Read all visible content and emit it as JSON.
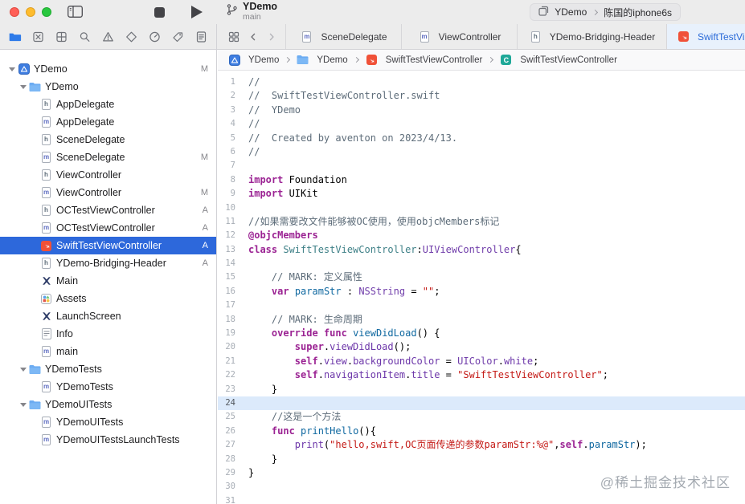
{
  "colors": {
    "accent_selection": "#2D68DB",
    "swift_orange": "#F05138",
    "active_tab_text": "#2A6AD8",
    "current_line_highlight": "#DCEAFB"
  },
  "titlebar": {
    "project": "YDemo",
    "branch": "main"
  },
  "run_destination": {
    "scheme": "YDemo",
    "device": "陈国的iphone6s"
  },
  "navigators": [
    {
      "name": "project-navigator",
      "icon": "folder",
      "active": true
    },
    {
      "name": "source-control-navigator",
      "icon": "square-x",
      "active": false
    },
    {
      "name": "symbol-navigator",
      "icon": "grid",
      "active": false
    },
    {
      "name": "find-navigator",
      "icon": "search",
      "active": false
    },
    {
      "name": "issue-navigator",
      "icon": "warning",
      "active": false
    },
    {
      "name": "test-navigator",
      "icon": "diamond",
      "active": false
    },
    {
      "name": "debug-navigator",
      "icon": "gauge",
      "active": false
    },
    {
      "name": "breakpoint-navigator",
      "icon": "tag",
      "active": false
    },
    {
      "name": "report-navigator",
      "icon": "doc-list",
      "active": false
    }
  ],
  "tabs": [
    {
      "label": "SceneDelegate",
      "icon": "file-m",
      "active": false
    },
    {
      "label": "ViewController",
      "icon": "file-m",
      "active": false
    },
    {
      "label": "YDemo-Bridging-Header",
      "icon": "file-h",
      "active": false
    },
    {
      "label": "SwiftTestViewController",
      "icon": "file-swift",
      "active": true
    }
  ],
  "jumpbar": [
    {
      "label": "YDemo",
      "icon": "project"
    },
    {
      "label": "YDemo",
      "icon": "folder-file"
    },
    {
      "label": "SwiftTestViewController",
      "icon": "file-swift"
    },
    {
      "label": "SwiftTestViewController",
      "icon": "symbol-c"
    }
  ],
  "sidebar": {
    "rows": [
      {
        "label": "YDemo",
        "icon": "project",
        "indent": 0,
        "disclosure": true,
        "badge": "M"
      },
      {
        "label": "YDemo",
        "icon": "folder-file",
        "indent": 1,
        "disclosure": true
      },
      {
        "label": "AppDelegate",
        "icon": "file-h",
        "indent": 2
      },
      {
        "label": "AppDelegate",
        "icon": "file-m",
        "indent": 2
      },
      {
        "label": "SceneDelegate",
        "icon": "file-h",
        "indent": 2
      },
      {
        "label": "SceneDelegate",
        "icon": "file-m",
        "indent": 2,
        "badge": "M"
      },
      {
        "label": "ViewController",
        "icon": "file-h",
        "indent": 2
      },
      {
        "label": "ViewController",
        "icon": "file-m",
        "indent": 2,
        "badge": "M"
      },
      {
        "label": "OCTestViewController",
        "icon": "file-h",
        "indent": 2,
        "badge": "A"
      },
      {
        "label": "OCTestViewController",
        "icon": "file-m",
        "indent": 2,
        "badge": "A"
      },
      {
        "label": "SwiftTestViewController",
        "icon": "file-swift",
        "indent": 2,
        "badge": "A",
        "selected": true
      },
      {
        "label": "YDemo-Bridging-Header",
        "icon": "file-h",
        "indent": 2,
        "badge": "A"
      },
      {
        "label": "Main",
        "icon": "storyboard",
        "indent": 2
      },
      {
        "label": "Assets",
        "icon": "assets",
        "indent": 2
      },
      {
        "label": "LaunchScreen",
        "icon": "storyboard",
        "indent": 2
      },
      {
        "label": "Info",
        "icon": "plist",
        "indent": 2
      },
      {
        "label": "main",
        "icon": "file-m",
        "indent": 2
      },
      {
        "label": "YDemoTests",
        "icon": "folder-file",
        "indent": 1,
        "disclosure": true
      },
      {
        "label": "YDemoTests",
        "icon": "file-m",
        "indent": 2
      },
      {
        "label": "YDemoUITests",
        "icon": "folder-file",
        "indent": 1,
        "disclosure": true
      },
      {
        "label": "YDemoUITests",
        "icon": "file-m",
        "indent": 2
      },
      {
        "label": "YDemoUITestsLaunchTests",
        "icon": "file-m",
        "indent": 2
      }
    ]
  },
  "editor": {
    "active_line": 24,
    "lines": [
      {
        "n": 1,
        "t": [
          [
            "//",
            "cmt"
          ]
        ]
      },
      {
        "n": 2,
        "t": [
          [
            "//  SwiftTestViewController.swift",
            "cmt"
          ]
        ]
      },
      {
        "n": 3,
        "t": [
          [
            "//  YDemo",
            "cmt"
          ]
        ]
      },
      {
        "n": 4,
        "t": [
          [
            "//",
            "cmt"
          ]
        ]
      },
      {
        "n": 5,
        "t": [
          [
            "//  Created by aventon on 2023/4/13.",
            "cmt"
          ]
        ]
      },
      {
        "n": 6,
        "t": [
          [
            "//",
            "cmt"
          ]
        ]
      },
      {
        "n": 7,
        "t": []
      },
      {
        "n": 8,
        "t": [
          [
            "import",
            "kw"
          ],
          [
            " Foundation",
            "pl"
          ]
        ]
      },
      {
        "n": 9,
        "t": [
          [
            "import",
            "kw"
          ],
          [
            " UIKit",
            "pl"
          ]
        ]
      },
      {
        "n": 10,
        "t": []
      },
      {
        "n": 11,
        "t": [
          [
            "//如果需要改文件能够被OC使用，使用objcMembers标记",
            "cmt"
          ]
        ]
      },
      {
        "n": 12,
        "t": [
          [
            "@objcMembers",
            "kw"
          ]
        ]
      },
      {
        "n": 13,
        "t": [
          [
            "class",
            "kw"
          ],
          [
            " ",
            "pl"
          ],
          [
            "SwiftTestViewController",
            "cls"
          ],
          [
            ":",
            "pl"
          ],
          [
            "UIViewController",
            "typ"
          ],
          [
            "{",
            "pl"
          ]
        ]
      },
      {
        "n": 14,
        "t": []
      },
      {
        "n": 15,
        "t": [
          [
            "    ",
            "pl"
          ],
          [
            "// MARK: 定义属性",
            "cmt"
          ]
        ]
      },
      {
        "n": 16,
        "t": [
          [
            "    ",
            "pl"
          ],
          [
            "var",
            "kw"
          ],
          [
            " ",
            "pl"
          ],
          [
            "paramStr",
            "dcl"
          ],
          [
            " : ",
            "pl"
          ],
          [
            "NSString",
            "typ"
          ],
          [
            " = ",
            "pl"
          ],
          [
            "\"\"",
            "str"
          ],
          [
            ";",
            "pl"
          ]
        ]
      },
      {
        "n": 17,
        "t": []
      },
      {
        "n": 18,
        "t": [
          [
            "    ",
            "pl"
          ],
          [
            "// MARK: 生命周期",
            "cmt"
          ]
        ]
      },
      {
        "n": 19,
        "t": [
          [
            "    ",
            "pl"
          ],
          [
            "override",
            "kw"
          ],
          [
            " ",
            "pl"
          ],
          [
            "func",
            "kw"
          ],
          [
            " ",
            "pl"
          ],
          [
            "viewDidLoad",
            "dcl"
          ],
          [
            "() {",
            "pl"
          ]
        ]
      },
      {
        "n": 20,
        "t": [
          [
            "        ",
            "pl"
          ],
          [
            "super",
            "kw"
          ],
          [
            ".",
            "pl"
          ],
          [
            "viewDidLoad",
            "mem"
          ],
          [
            "();",
            "pl"
          ]
        ]
      },
      {
        "n": 21,
        "t": [
          [
            "        ",
            "pl"
          ],
          [
            "self",
            "kw"
          ],
          [
            ".",
            "pl"
          ],
          [
            "view",
            "mem"
          ],
          [
            ".",
            "pl"
          ],
          [
            "backgroundColor",
            "mem"
          ],
          [
            " = ",
            "pl"
          ],
          [
            "UIColor",
            "typ"
          ],
          [
            ".",
            "pl"
          ],
          [
            "white",
            "mem"
          ],
          [
            ";",
            "pl"
          ]
        ]
      },
      {
        "n": 22,
        "t": [
          [
            "        ",
            "pl"
          ],
          [
            "self",
            "kw"
          ],
          [
            ".",
            "pl"
          ],
          [
            "navigationItem",
            "mem"
          ],
          [
            ".",
            "pl"
          ],
          [
            "title",
            "mem"
          ],
          [
            " = ",
            "pl"
          ],
          [
            "\"SwiftTestViewController\"",
            "str"
          ],
          [
            ";",
            "pl"
          ]
        ]
      },
      {
        "n": 23,
        "t": [
          [
            "    }",
            "pl"
          ]
        ]
      },
      {
        "n": 24,
        "t": []
      },
      {
        "n": 25,
        "t": [
          [
            "    ",
            "pl"
          ],
          [
            "//这是一个方法",
            "cmt"
          ]
        ]
      },
      {
        "n": 26,
        "t": [
          [
            "    ",
            "pl"
          ],
          [
            "func",
            "kw"
          ],
          [
            " ",
            "pl"
          ],
          [
            "printHello",
            "dcl"
          ],
          [
            "(){",
            "pl"
          ]
        ]
      },
      {
        "n": 27,
        "t": [
          [
            "        ",
            "pl"
          ],
          [
            "print",
            "mem"
          ],
          [
            "(",
            "pl"
          ],
          [
            "\"hello,swift,OC页面传递的参数paramStr:%@\"",
            "str"
          ],
          [
            ",",
            "pl"
          ],
          [
            "self",
            "kw"
          ],
          [
            ".",
            "pl"
          ],
          [
            "paramStr",
            "dcl"
          ],
          [
            ");",
            "pl"
          ]
        ]
      },
      {
        "n": 28,
        "t": [
          [
            "    }",
            "pl"
          ]
        ]
      },
      {
        "n": 29,
        "t": [
          [
            "}",
            "pl"
          ]
        ]
      },
      {
        "n": 30,
        "t": []
      },
      {
        "n": 31,
        "t": []
      }
    ]
  },
  "watermark": "@稀土掘金技术社区"
}
